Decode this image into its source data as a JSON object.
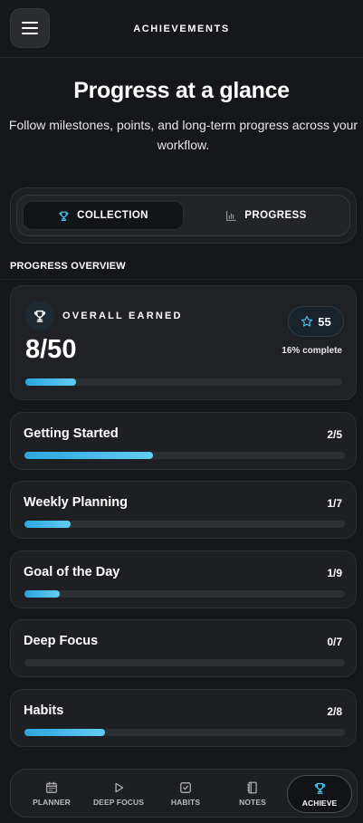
{
  "header": {
    "title": "ACHIEVEMENTS",
    "menu_icon": "hamburger-menu-icon"
  },
  "hero": {
    "title": "Progress at a glance",
    "subtitle": "Follow milestones, points, and long-term progress across your workflow."
  },
  "tabs": [
    {
      "label": "COLLECTION",
      "icon": "trophy-icon",
      "active": true
    },
    {
      "label": "PROGRESS",
      "icon": "bar-chart-icon",
      "active": false
    }
  ],
  "section_label": "PROGRESS OVERVIEW",
  "overall": {
    "label": "OVERALL EARNED",
    "value": "8/50",
    "points": "55",
    "percent_text": "16% complete",
    "progress": 0.16
  },
  "categories": [
    {
      "name": "Getting Started",
      "count": "2/5",
      "progress": 0.4
    },
    {
      "name": "Weekly Planning",
      "count": "1/7",
      "progress": 0.143
    },
    {
      "name": "Goal of the Day",
      "count": "1/9",
      "progress": 0.111
    },
    {
      "name": "Deep Focus",
      "count": "0/7",
      "progress": 0
    },
    {
      "name": "Habits",
      "count": "2/8",
      "progress": 0.25
    }
  ],
  "nav": [
    {
      "label": "PLANNER",
      "icon": "calendar-icon"
    },
    {
      "label": "DEEP FOCUS",
      "icon": "play-icon"
    },
    {
      "label": "HABITS",
      "icon": "checkbox-icon"
    },
    {
      "label": "NOTES",
      "icon": "notebook-icon"
    },
    {
      "label": "ACHIEVE",
      "icon": "trophy-icon",
      "active": true
    }
  ],
  "colors": {
    "accent": "#4cc3ef",
    "background": "#16171a",
    "card": "#1e1f23"
  }
}
